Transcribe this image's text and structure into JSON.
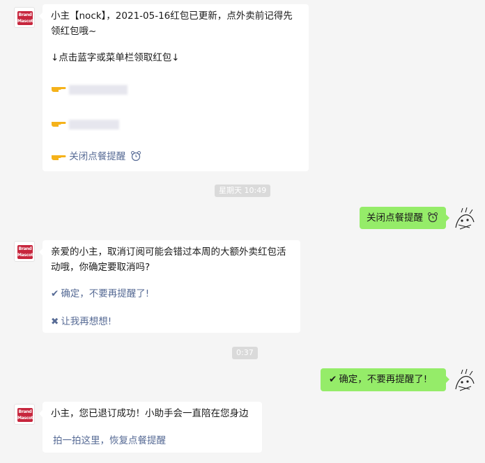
{
  "brand_avatar_text": [
    "Brand",
    "Mascot"
  ],
  "messages": {
    "m1": {
      "line1": "小主【nock】，2021-05-16红包已更新，点外卖前记得先",
      "line2": "领红包哦~",
      "line3": "↓点击蓝字或菜单栏领取红包↓",
      "close_link": "关闭点餐提醒"
    },
    "time1": "星期天 10:49",
    "m2": {
      "text": "关闭点餐提醒"
    },
    "m3": {
      "line1": "亲爱的小主，取消订阅可能会错过本周的大额外卖红包活",
      "line2": "动哦，你确定要取消吗?",
      "confirm": "确定，不要再提醒了!",
      "reconsider": "让我再想想!"
    },
    "time2": "0:37",
    "m4": {
      "text": "确定，不要再提醒了!"
    },
    "m5": {
      "line1": "小主，您已退订成功！小助手会一直陪在您身边",
      "restore_link": "拍一拍这里，恢复点餐提醒"
    }
  },
  "icons": {
    "pointing_hand": "pointing-hand-icon",
    "alarm_clock": "alarm-clock-icon",
    "check": "check-icon",
    "cross": "cross-icon"
  },
  "colors": {
    "background": "#f5f5f5",
    "bubble_in": "#ffffff",
    "bubble_out": "#95ec69",
    "link": "#576b95",
    "time_pill": "#dadada"
  }
}
